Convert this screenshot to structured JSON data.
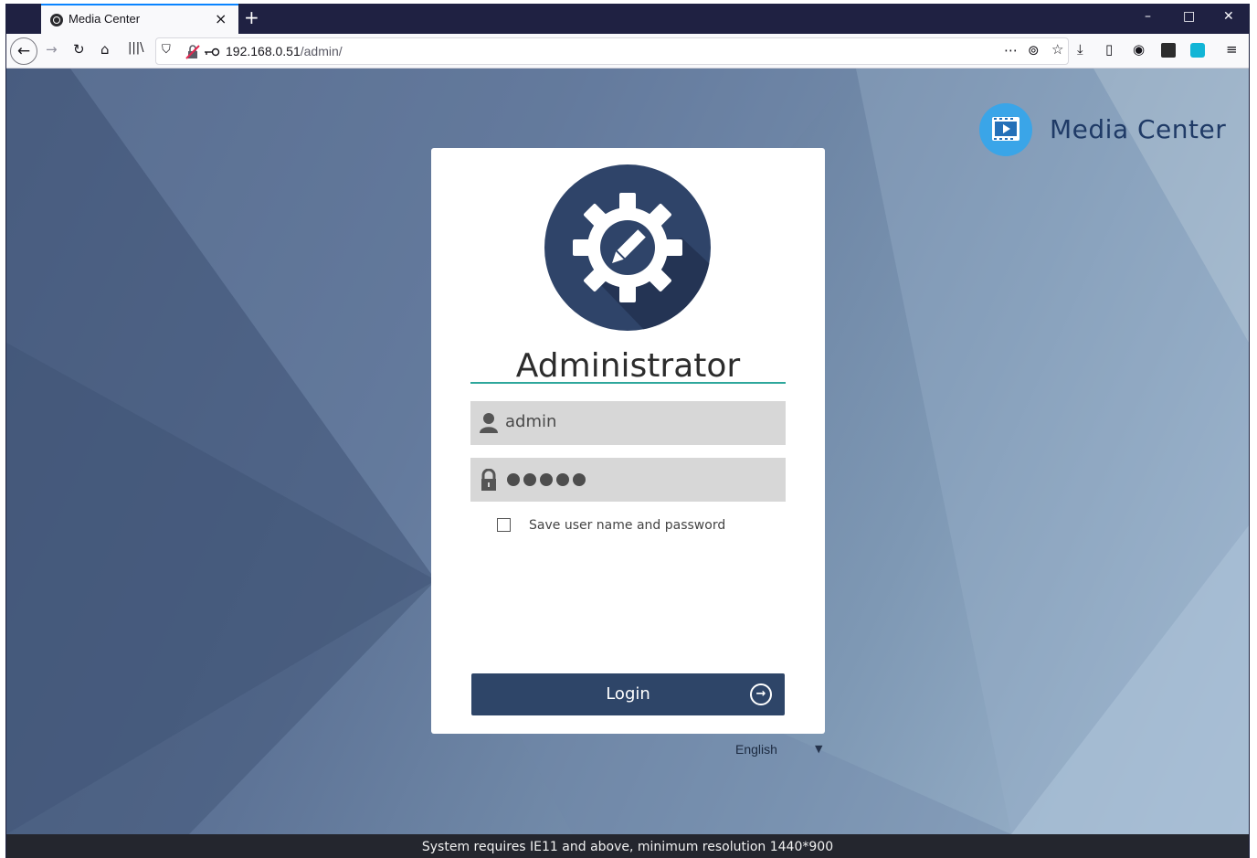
{
  "browser": {
    "tab_title": "Media Center",
    "tab_close": "×",
    "new_tab": "+",
    "url_host": "192.168.0.51",
    "url_path": "/admin/",
    "window_minimize": "–",
    "window_maximize": "□",
    "window_close": "✕"
  },
  "brand": {
    "name": "Media Center"
  },
  "login": {
    "title": "Administrator",
    "username_value": "admin",
    "password_dots": 5,
    "remember_label": "Save user name and password",
    "remember_checked": false,
    "button_label": "Login"
  },
  "language": {
    "selected": "English"
  },
  "footer": {
    "notice": "System requires IE11 and above, minimum resolution 1440*900"
  },
  "colors": {
    "titlebar": "#1f2142",
    "card_button": "#2e4568",
    "accent_line": "#2ea79c",
    "brand_blue": "#3aa5e8"
  },
  "icons": {
    "favicon": "media-center-icon",
    "avatar": "gear-pencil-icon",
    "username": "user-icon",
    "password": "lock-icon",
    "login_arrow": "arrow-circle-right-icon"
  }
}
